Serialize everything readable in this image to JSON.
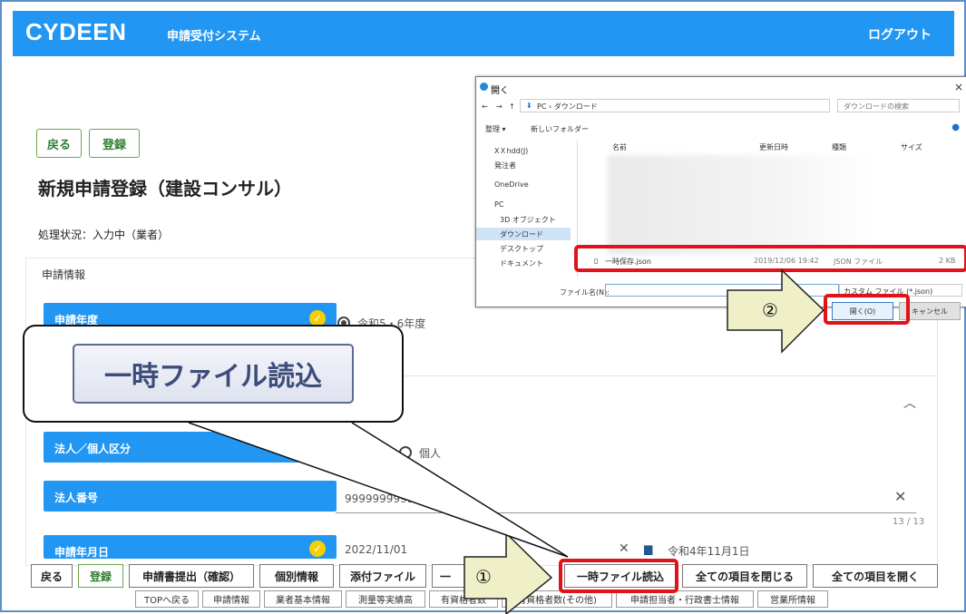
{
  "header": {
    "logo": "CYDEEN",
    "system_title": "申請受付システム",
    "logout": "ログアウト"
  },
  "top_buttons": {
    "back": "戻る",
    "register": "登録"
  },
  "page": {
    "title": "新規申請登録（建設コンサル）",
    "status": "処理状況：入力中（業者）",
    "section": "申請情報"
  },
  "fields": {
    "year": {
      "label": "申請年度",
      "value": "令和5・6年度"
    },
    "kind": {
      "label": "法人／個人区分",
      "option_individual": "個人"
    },
    "corp_no": {
      "label": "法人番号",
      "value": "9999999999999",
      "counter": "13 / 13"
    },
    "date": {
      "label": "申請年月日",
      "value": "2022/11/01",
      "wareki": "令和4年11月1日"
    }
  },
  "toolbar": {
    "buttons": [
      "戻る",
      "登録",
      "申請書提出（確認）",
      "個別情報",
      "添付ファイル",
      "一時ファイル読込",
      "全ての項目を閉じる",
      "全ての項目を開く"
    ],
    "nav": [
      "TOPへ戻る",
      "申請情報",
      "業者基本情報",
      "測量等実績高",
      "有資格者数",
      "有資格者数(その他)",
      "申請担当者・行政書士情報",
      "営業所情報"
    ]
  },
  "dialog": {
    "title": "開く",
    "path": "PC › ダウンロード",
    "search_placeholder": "ダウンロードの検索",
    "organize": "整理 ▾",
    "new_folder": "新しいフォルダー",
    "col_name": "名前",
    "col_date": "更新日時",
    "col_type": "種類",
    "col_size": "サイズ",
    "tree": [
      "ⅩＸhdd(J)",
      "発注者",
      "OneDrive",
      "PC",
      "3D オブジェクト",
      "ダウンロード",
      "デスクトップ",
      "ドキュメント"
    ],
    "file": {
      "name": "一時保存.json",
      "date": "2019/12/06 19:42",
      "type": "JSON ファイル",
      "size": "2 KB"
    },
    "filename_label": "ファイル名(N):",
    "filter": "カスタム ファイル (*.json)",
    "open": "開く(O)",
    "cancel": "キャンセル"
  },
  "callout": {
    "text": "一時ファイル読込"
  },
  "markers": {
    "one": "①",
    "two": "②"
  },
  "colors": {
    "header": "#2196f3",
    "label": "#2196f3",
    "highlight": "#e0131b",
    "accent_green": "#2e7d32"
  }
}
